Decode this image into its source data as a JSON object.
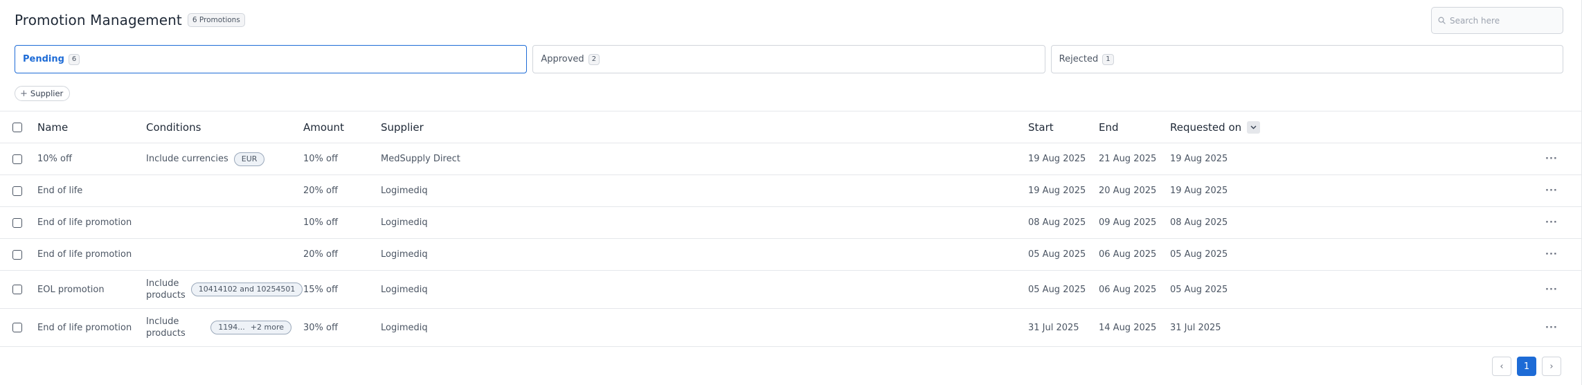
{
  "header": {
    "title": "Promotion Management",
    "count_badge": "6 Promotions"
  },
  "search": {
    "placeholder": "Search here",
    "value": ""
  },
  "tabs": [
    {
      "label": "Pending",
      "count": "6",
      "active": true
    },
    {
      "label": "Approved",
      "count": "2",
      "active": false
    },
    {
      "label": "Rejected",
      "count": "1",
      "active": false
    }
  ],
  "filters": {
    "supplier_chip": "Supplier"
  },
  "table": {
    "columns": {
      "name": "Name",
      "conditions": "Conditions",
      "amount": "Amount",
      "supplier": "Supplier",
      "start": "Start",
      "end": "End",
      "requested_on": "Requested on"
    },
    "rows": [
      {
        "name": "10% off",
        "condition": "Include currencies",
        "pill": "EUR",
        "pill_extra": "",
        "amount": "10% off",
        "supplier": "MedSupply Direct",
        "start": "19 Aug 2025",
        "end": "21 Aug 2025",
        "requested_on": "19 Aug 2025"
      },
      {
        "name": "End of life",
        "condition": "",
        "pill": "",
        "pill_extra": "",
        "amount": "20% off",
        "supplier": "Logimediq",
        "start": "19 Aug 2025",
        "end": "20 Aug 2025",
        "requested_on": "19 Aug 2025"
      },
      {
        "name": "End of life promotion",
        "condition": "",
        "pill": "",
        "pill_extra": "",
        "amount": "10% off",
        "supplier": "Logimediq",
        "start": "08 Aug 2025",
        "end": "09 Aug 2025",
        "requested_on": "08 Aug 2025"
      },
      {
        "name": "End of life promotion",
        "condition": "",
        "pill": "",
        "pill_extra": "",
        "amount": "20% off",
        "supplier": "Logimediq",
        "start": "05 Aug 2025",
        "end": "06 Aug 2025",
        "requested_on": "05 Aug 2025"
      },
      {
        "name": "EOL promotion",
        "condition": "Include products",
        "pill": "10414102 and 10254501",
        "pill_extra": "",
        "amount": "15% off",
        "supplier": "Logimediq",
        "start": "05 Aug 2025",
        "end": "06 Aug 2025",
        "requested_on": "05 Aug 2025"
      },
      {
        "name": "End of life promotion",
        "condition": "Include products",
        "pill": "1194...",
        "pill_extra": "+2 more",
        "amount": "30% off",
        "supplier": "Logimediq",
        "start": "31 Jul 2025",
        "end": "14 Aug 2025",
        "requested_on": "31 Jul 2025"
      }
    ],
    "row_menu_glyph": "···"
  },
  "pagination": {
    "prev": "‹",
    "current": "1",
    "next": "›"
  },
  "colors": {
    "accent": "#1d6bd6",
    "border": "#d1d5db"
  }
}
